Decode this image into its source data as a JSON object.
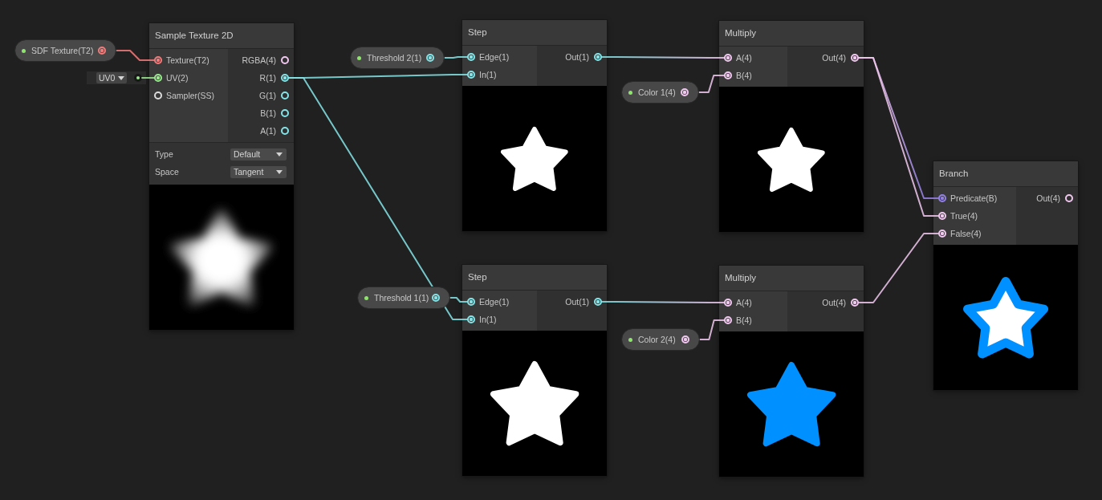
{
  "nodes": [
    {
      "title": "Sample Texture 2D",
      "inputs": [
        {
          "label": "Texture(T2)",
          "color": "#f27c7c",
          "connected": true
        },
        {
          "label": "UV(2)",
          "color": "#9ae98f",
          "connected": true,
          "inline_value": "UV0"
        },
        {
          "label": "Sampler(SS)",
          "color": "#dcdcdc",
          "connected": false
        }
      ],
      "outputs": [
        {
          "label": "RGBA(4)",
          "color": "#f1c8ef",
          "connected": false
        },
        {
          "label": "R(1)",
          "color": "#84e4e7",
          "connected": true
        },
        {
          "label": "G(1)",
          "color": "#84e4e7",
          "connected": false
        },
        {
          "label": "B(1)",
          "color": "#84e4e7",
          "connected": false
        },
        {
          "label": "A(1)",
          "color": "#84e4e7",
          "connected": false
        }
      ],
      "settings": [
        {
          "label": "Type",
          "value": "Default"
        },
        {
          "label": "Space",
          "value": "Tangent"
        }
      ],
      "preview": {
        "kind": "blur",
        "color": "#ffffff"
      }
    },
    {
      "title": "Step",
      "inputs": [
        {
          "label": "Edge(1)",
          "color": "#84e4e7",
          "connected": true
        },
        {
          "label": "In(1)",
          "color": "#84e4e7",
          "connected": true
        }
      ],
      "outputs": [
        {
          "label": "Out(1)",
          "color": "#84e4e7",
          "connected": true
        }
      ],
      "preview": {
        "kind": "solid",
        "color": "#ffffff"
      }
    },
    {
      "title": "Multiply",
      "inputs": [
        {
          "label": "A(4)",
          "color": "#f1c8ef",
          "connected": true
        },
        {
          "label": "B(4)",
          "color": "#f1c8ef",
          "connected": true
        }
      ],
      "outputs": [
        {
          "label": "Out(4)",
          "color": "#f1c8ef",
          "connected": true
        }
      ],
      "preview": {
        "kind": "solid",
        "color": "#ffffff"
      }
    },
    {
      "title": "Branch",
      "inputs": [
        {
          "label": "Predicate(B)",
          "color": "#9481e6",
          "connected": true
        },
        {
          "label": "True(4)",
          "color": "#f1c8ef",
          "connected": true
        },
        {
          "label": "False(4)",
          "color": "#f1c8ef",
          "connected": true
        }
      ],
      "outputs": [
        {
          "label": "Out(4)",
          "color": "#f1c8ef",
          "connected": false
        }
      ],
      "preview": {
        "kind": "outline",
        "color": "#0090ff"
      }
    },
    {
      "title": "Step",
      "inputs": [
        {
          "label": "Edge(1)",
          "color": "#84e4e7",
          "connected": true
        },
        {
          "label": "In(1)",
          "color": "#84e4e7",
          "connected": true
        }
      ],
      "outputs": [
        {
          "label": "Out(1)",
          "color": "#84e4e7",
          "connected": true
        }
      ],
      "preview": {
        "kind": "solid",
        "color": "#ffffff"
      }
    },
    {
      "title": "Multiply",
      "inputs": [
        {
          "label": "A(4)",
          "color": "#f1c8ef",
          "connected": true
        },
        {
          "label": "B(4)",
          "color": "#f1c8ef",
          "connected": true
        }
      ],
      "outputs": [
        {
          "label": "Out(4)",
          "color": "#f1c8ef",
          "connected": true
        }
      ],
      "preview": {
        "kind": "solid",
        "color": "#0090ff"
      }
    }
  ],
  "properties": [
    {
      "label": "SDF Texture(T2)",
      "color": "#f27c7c",
      "connected": true
    },
    {
      "label": "Threshold 2(1)",
      "color": "#84e4e7",
      "connected": true
    },
    {
      "label": "Color 1(4)",
      "color": "#f1c8ef",
      "connected": true
    },
    {
      "label": "Threshold 1(1)",
      "color": "#84e4e7",
      "connected": true
    },
    {
      "label": "Color 2(4)",
      "color": "#f1c8ef",
      "connected": true
    }
  ]
}
